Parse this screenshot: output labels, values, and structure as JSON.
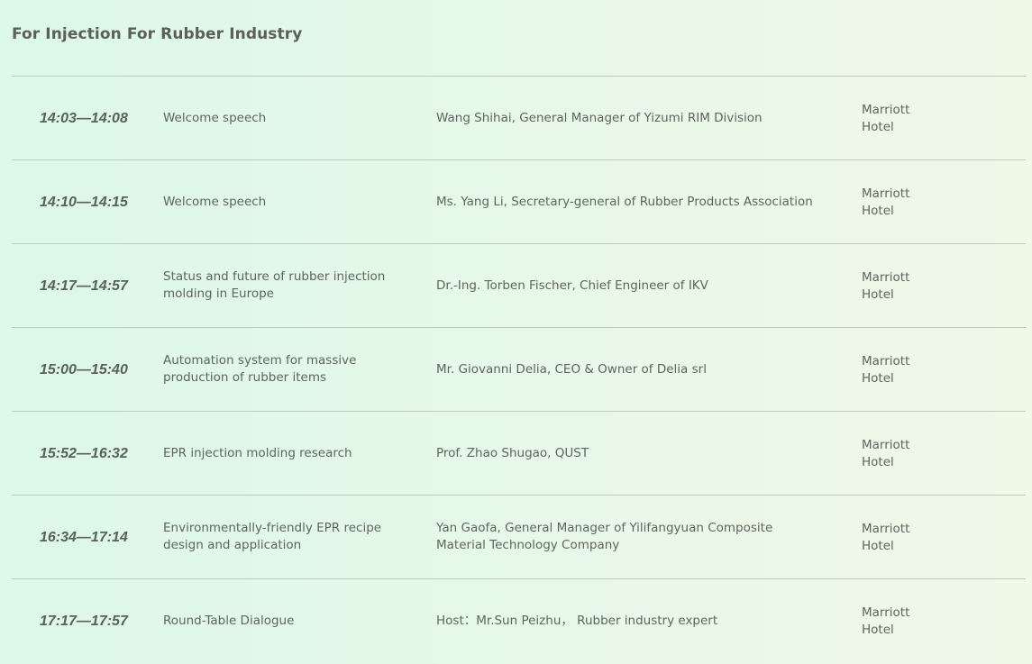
{
  "section": {
    "title": "For Injection For Rubber Industry"
  },
  "schedule": [
    {
      "time": "14:03—14:08",
      "topic": "Welcome speech",
      "speaker": "Wang Shihai, General Manager of Yizumi RIM Division",
      "venue": "Marriott\nHotel"
    },
    {
      "time": "14:10—14:15",
      "topic": "Welcome speech",
      "speaker": "Ms. Yang Li, Secretary-general of Rubber Products Association",
      "venue": "Marriott\nHotel"
    },
    {
      "time": "14:17—14:57",
      "topic": "Status and future of rubber injection molding in Europe",
      "speaker": "Dr.-Ing. Torben Fischer, Chief Engineer of IKV",
      "venue": "Marriott\nHotel"
    },
    {
      "time": "15:00—15:40",
      "topic": "Automation system for massive production of rubber items",
      "speaker": "Mr. Giovanni Delia, CEO & Owner of Delia srl",
      "venue": "Marriott\nHotel"
    },
    {
      "time": "15:52—16:32",
      "topic": "EPR injection molding research",
      "speaker": "Prof. Zhao Shugao, QUST",
      "venue": "Marriott\nHotel"
    },
    {
      "time": "16:34—17:14",
      "topic": "Environmentally-friendly EPR recipe design and application",
      "speaker": "Yan Gaofa, General Manager of Yilifangyuan Composite Material Technology Company",
      "venue": "Marriott\nHotel"
    },
    {
      "time": "17:17—17:57",
      "topic": "Round-Table Dialogue",
      "speaker": "Host：Mr.Sun Peizhu， Rubber industry expert",
      "venue": "Marriott\nHotel"
    }
  ]
}
